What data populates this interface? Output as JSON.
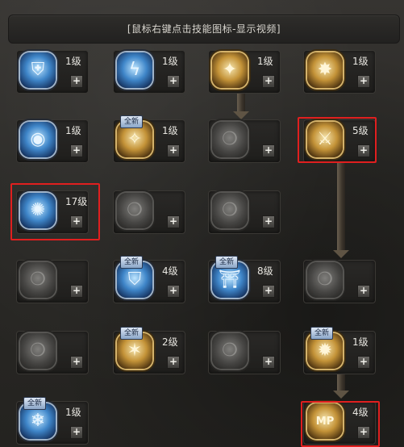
{
  "hint": "[鼠标右键点击技能图标-显示视频]",
  "new_badge": "全新",
  "plus_label": "+",
  "skills": [
    {
      "id": "r1c1",
      "icon": "shield-icon",
      "style": "blue",
      "glyph": "⛨",
      "level": "1级"
    },
    {
      "id": "r1c2",
      "icon": "lightning-icon",
      "style": "blue",
      "glyph": "ϟ",
      "level": "1级"
    },
    {
      "id": "r1c3",
      "icon": "phoenix-icon",
      "style": "gold",
      "glyph": "✦",
      "level": "1级"
    },
    {
      "id": "r1c4",
      "icon": "boot-kick-icon",
      "style": "gold",
      "glyph": "✸",
      "level": "1级"
    },
    {
      "id": "r2c1",
      "icon": "eye-ward-icon",
      "style": "blue",
      "glyph": "◉",
      "level": "1级"
    },
    {
      "id": "r2c2",
      "icon": "holy-figure-icon",
      "style": "gold",
      "glyph": "✧",
      "level": "1级",
      "badge": true
    },
    {
      "id": "r2c3",
      "icon": "locked-skill-icon",
      "style": "grey",
      "glyph": "❍",
      "level": ""
    },
    {
      "id": "r2c4",
      "icon": "sword-slash-icon",
      "style": "gold",
      "glyph": "⚔",
      "level": "5级"
    },
    {
      "id": "r3c1",
      "icon": "ice-shatter-icon",
      "style": "blue",
      "glyph": "✺",
      "level": "17级"
    },
    {
      "id": "r3c2",
      "icon": "locked-skill-icon",
      "style": "grey",
      "glyph": "❍",
      "level": ""
    },
    {
      "id": "r3c3",
      "icon": "locked-skill-icon",
      "style": "grey",
      "glyph": "❍",
      "level": ""
    },
    {
      "id": "r4c1",
      "icon": "locked-skill-icon",
      "style": "grey",
      "glyph": "❍",
      "level": ""
    },
    {
      "id": "r4c2",
      "icon": "tower-shield-icon",
      "style": "blue",
      "glyph": "⛉",
      "level": "4级",
      "badge": true
    },
    {
      "id": "r4c3",
      "icon": "twin-pillar-icon",
      "style": "blue",
      "glyph": "⛩",
      "level": "8级",
      "badge": true
    },
    {
      "id": "r4c4",
      "icon": "locked-skill-icon",
      "style": "grey",
      "glyph": "❍",
      "level": ""
    },
    {
      "id": "r5c1",
      "icon": "locked-skill-icon",
      "style": "grey",
      "glyph": "❍",
      "level": ""
    },
    {
      "id": "r5c2",
      "icon": "golden-strike-icon",
      "style": "gold",
      "glyph": "✶",
      "level": "2级",
      "badge": true
    },
    {
      "id": "r5c3",
      "icon": "locked-skill-icon",
      "style": "grey",
      "glyph": "❍",
      "level": ""
    },
    {
      "id": "r5c4",
      "icon": "radiant-burst-icon",
      "style": "gold",
      "glyph": "✹",
      "level": "1级",
      "badge": true
    },
    {
      "id": "r6c1",
      "icon": "frost-aura-icon",
      "style": "blue",
      "glyph": "❄",
      "level": "1级",
      "badge": true
    },
    {
      "id": "r6c4",
      "icon": "mp-boost-icon",
      "style": "gold",
      "glyph": "MP",
      "level": "4级"
    }
  ]
}
